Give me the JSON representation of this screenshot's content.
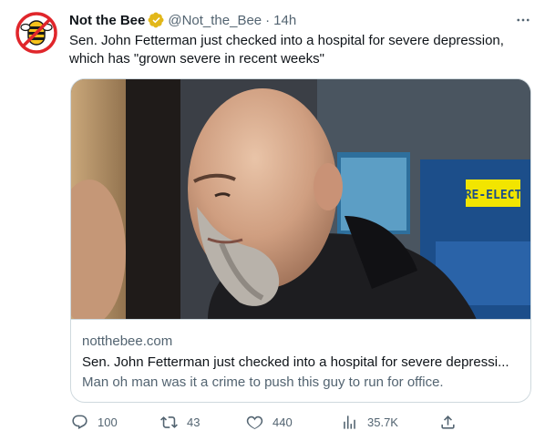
{
  "tweet": {
    "display_name": "Not the Bee",
    "handle": "@Not_the_Bee",
    "separator": "·",
    "time": "14h",
    "text": "Sen. John Fetterman just checked into a hospital for severe depression, which has \"grown severe in recent weeks\""
  },
  "card": {
    "domain": "notthebee.com",
    "title": "Sen. John Fetterman just checked into a hospital for severe depressi...",
    "description": "Man oh man was it a crime to push this guy to run for office.",
    "image_poster_text": "RE-ELECT"
  },
  "actions": {
    "replies": "100",
    "retweets": "43",
    "likes": "440",
    "views": "35.7K"
  },
  "icons": {
    "avatar": "not-the-bee-logo",
    "verified": "gold-verified-badge-icon",
    "more": "more-icon",
    "reply": "reply-icon",
    "retweet": "retweet-icon",
    "like": "heart-icon",
    "views": "views-icon",
    "share": "share-icon"
  },
  "colors": {
    "text": "#0f1419",
    "secondary": "#536471",
    "border": "#cfd9de",
    "verified_gold": "#e2b719",
    "logo_red": "#e0262b",
    "logo_yellow": "#f6c21b"
  }
}
